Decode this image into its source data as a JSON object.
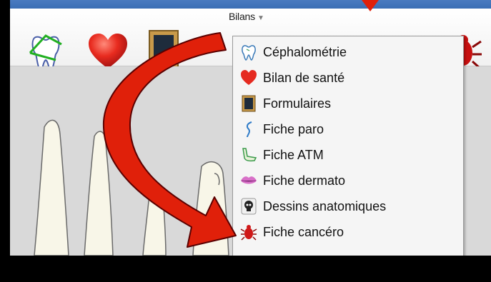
{
  "menu": {
    "title": "Bilans",
    "items": [
      {
        "label": "Céphalométrie",
        "icon": "tooth-outline-icon"
      },
      {
        "label": "Bilan de santé",
        "icon": "heart-icon"
      },
      {
        "label": "Formulaires",
        "icon": "form-frame-icon"
      },
      {
        "label": "Fiche paro",
        "icon": "paro-probe-icon"
      },
      {
        "label": "Fiche ATM",
        "icon": "jaw-icon"
      },
      {
        "label": "Fiche dermato",
        "icon": "lips-icon"
      },
      {
        "label": "Dessins anatomiques",
        "icon": "skull-icon"
      },
      {
        "label": "Fiche cancéro",
        "icon": "bug-icon"
      }
    ]
  },
  "toolbar": {
    "icons": [
      "tooth-angle-icon",
      "heart-icon",
      "frame-icon",
      "bug-icon"
    ]
  },
  "colors": {
    "background": "#000000",
    "accent_arrow": "#e0200a",
    "menu_bg": "#f5f5f5"
  }
}
